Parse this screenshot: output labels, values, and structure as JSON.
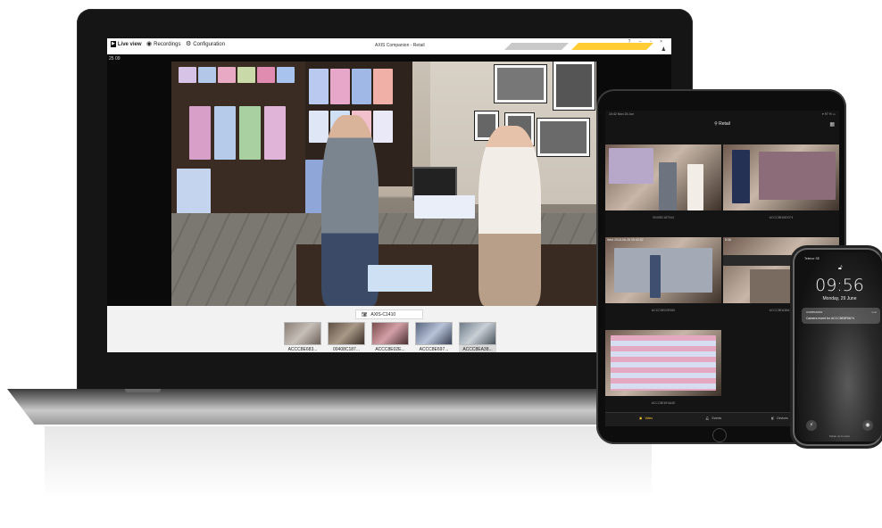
{
  "laptop": {
    "tabs": [
      {
        "label": "Live view",
        "icon": "live-view-icon"
      },
      {
        "label": "Recordings",
        "icon": "recordings-icon"
      },
      {
        "label": "Configuration",
        "icon": "gear-icon"
      }
    ],
    "window_title": "AXIS Companion - Retail",
    "window_controls": "? – ▫ ×",
    "timestamp": "25 09",
    "camera_label": "AXIS-C1410",
    "thumbnails": [
      {
        "label": "ACCC8E683..."
      },
      {
        "label": "00408C187..."
      },
      {
        "label": "ACCC8E02E..."
      },
      {
        "label": "ACCC8E697..."
      },
      {
        "label": "ACCC8EA38...",
        "selected": true
      }
    ],
    "accent_color": "#ffcc33"
  },
  "tablet": {
    "status_left": "10:42  Mon 26 Jun",
    "status_right": "▾ 97 % ▭",
    "title": "Retail",
    "cells": [
      {
        "label": "00408C187044"
      },
      {
        "label": "ACCC8E682CF4"
      },
      {
        "label": "ACCC8E02E060",
        "timestamp": "Wed 2015-06-26 09:43:52"
      },
      {
        "label": "ACCC8EA38A76",
        "timestamp": "5:36"
      },
      {
        "label": "ACCC8E6F4A4E"
      }
    ],
    "nav": [
      {
        "label": "Video",
        "icon": "video-icon"
      },
      {
        "label": "Events",
        "icon": "bell-icon"
      },
      {
        "label": "Devices",
        "icon": "camera-icon"
      }
    ]
  },
  "phone": {
    "carrier": "Telenor SE",
    "time": "09:56",
    "date": "Monday, 29 June",
    "notification": {
      "app": "COMPANION",
      "time": "now",
      "message": "Camera event for ACCC8E8F6674"
    },
    "swipe_hint": "Swipe up to open"
  }
}
